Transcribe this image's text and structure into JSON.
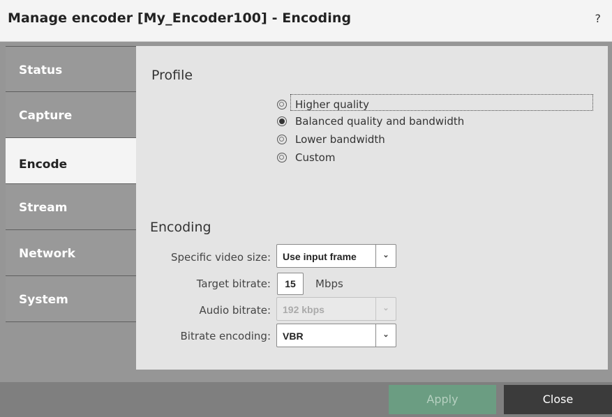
{
  "window": {
    "title": "Manage encoder [My_Encoder100] - Encoding",
    "help": "?"
  },
  "sidebar": {
    "items": [
      {
        "label": "Status"
      },
      {
        "label": "Capture"
      },
      {
        "label": "Encode",
        "active": true
      },
      {
        "label": "Stream"
      },
      {
        "label": "Network"
      },
      {
        "label": "System"
      }
    ]
  },
  "profile": {
    "title": "Profile",
    "options": [
      {
        "label": "Higher quality",
        "checked": false
      },
      {
        "label": "Balanced quality and bandwidth",
        "checked": true
      },
      {
        "label": "Lower bandwidth",
        "checked": false
      },
      {
        "label": "Custom",
        "checked": false
      }
    ]
  },
  "encoding": {
    "title": "Encoding",
    "video_size": {
      "label": "Specific video size:",
      "value": "Use input frame"
    },
    "target_bitrate": {
      "label": "Target bitrate:",
      "value": "15",
      "unit": "Mbps"
    },
    "audio_bitrate": {
      "label": "Audio bitrate:",
      "value": "192 kbps",
      "disabled": true
    },
    "bitrate_encoding": {
      "label": "Bitrate encoding:",
      "value": "VBR"
    }
  },
  "footer": {
    "apply_label": "Apply",
    "close_label": "Close"
  },
  "colors": {
    "apply_bg": "#6b9d82",
    "close_bg": "#3b3b3b",
    "sidebar_bg": "#999999",
    "panel_bg": "#e4e4e4"
  }
}
